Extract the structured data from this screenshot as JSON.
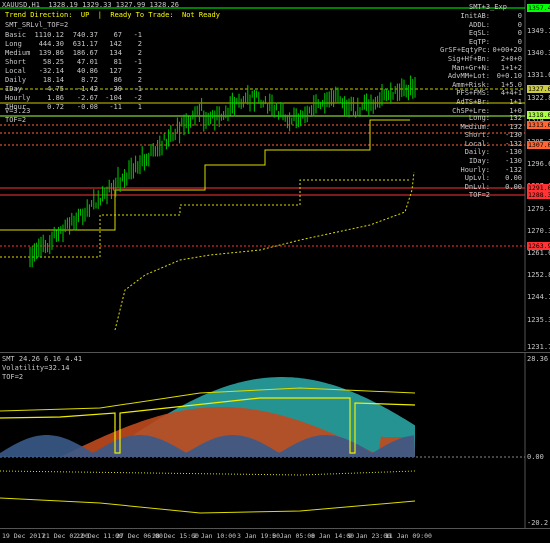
{
  "header": {
    "symbol_line": "XAUUSD,H1  1328.19 1329.33 1327.99 1328.26",
    "trend_line": "Trend Direction:  UP  |  Ready To Trade:  Not Ready",
    "smt_srl_line": "SMT_SRLvl_TOF=2",
    "corner_label": "SMT+3_Exp"
  },
  "stats_table": [
    {
      "name": "Basic",
      "a": "1110.12",
      "b": "740.37",
      "c": "67",
      "d": "-1"
    },
    {
      "name": "Long",
      "a": "444.30",
      "b": "631.17",
      "c": "142",
      "d": "2"
    },
    {
      "name": "Medium",
      "a": "139.86",
      "b": "186.67",
      "c": "134",
      "d": "2"
    },
    {
      "name": "Short",
      "a": "58.25",
      "b": "47.01",
      "c": "81",
      "d": "-1"
    },
    {
      "name": "Local",
      "a": "-32.14",
      "b": "40.86",
      "c": "127",
      "d": "2"
    },
    {
      "name": "Daily",
      "a": "18.14",
      "b": "8.72",
      "c": "86",
      "d": "2"
    },
    {
      "name": "IDay",
      "a": "4.75",
      "b": "-1.42",
      "c": "-30",
      "d": "-1"
    },
    {
      "name": "Hourly",
      "a": "1.86",
      "b": "-2.67",
      "c": "-104",
      "d": "-2"
    },
    {
      "name": "IHour",
      "a": "0.72",
      "b": "-0.08",
      "c": "-11",
      "d": "1"
    }
  ],
  "v_line": "V=3.23",
  "tof_line": "TOF=2",
  "right_panel_top": [
    {
      "label": "InitAB:",
      "value": "0"
    },
    {
      "label": "ADDL:",
      "value": "0"
    },
    {
      "label": "EqSL:",
      "value": "0"
    },
    {
      "label": "EqTP:",
      "value": "0"
    },
    {
      "label": "GrSF+EqtyPc:",
      "value": "0+00+20"
    },
    {
      "label": "Sig+Hf+Bn:",
      "value": "2+0+0"
    },
    {
      "label": "Man+Gr+N:",
      "value": "1+1+2"
    },
    {
      "label": "AdvMM+Lot:",
      "value": "0+0.10"
    },
    {
      "label": "Amm+Risk:",
      "value": "1+5.0"
    },
    {
      "label": "PFS+FMS:",
      "value": "4+4+1"
    },
    {
      "label": "AdTS+Br:",
      "value": "1+1"
    },
    {
      "label": "ChSP+Lre:",
      "value": "1+0"
    }
  ],
  "right_panel_bottom": [
    {
      "label": "Long:",
      "value": "132"
    },
    {
      "label": "Medium:",
      "value": "132"
    },
    {
      "label": "Short:",
      "value": "-130"
    },
    {
      "label": "Local:",
      "value": "-132"
    },
    {
      "label": "Daily:",
      "value": "-130"
    },
    {
      "label": "IDay:",
      "value": "-130"
    },
    {
      "label": "Hourly:",
      "value": "-132"
    },
    {
      "label": "UpLvl:",
      "value": "0.00"
    },
    {
      "label": "DnLvl:",
      "value": "0.00"
    },
    {
      "label": "TOF=2",
      "value": ""
    }
  ],
  "price_axis": {
    "ticks": [
      "1349.10",
      "1340.35",
      "1331.60",
      "1322.85",
      "1314.10",
      "1305.35",
      "1296.60",
      "1287.85",
      "1279.10",
      "1270.35",
      "1261.60",
      "1252.85",
      "1244.10",
      "1235.35"
    ],
    "labels": [
      {
        "text": "1357.40",
        "color": "#00ff00"
      },
      {
        "text": "1327.65",
        "color": "#cccc44"
      },
      {
        "text": "1318.00",
        "color": "#aaff44"
      },
      {
        "text": "1313.60",
        "color": "#ff6633"
      },
      {
        "text": "1307.00",
        "color": "#ff6633"
      },
      {
        "text": "1291.00",
        "color": "#ff3333"
      },
      {
        "text": "1288.30",
        "color": "#ff3333"
      },
      {
        "text": "1263.90",
        "color": "#ff3333"
      }
    ],
    "bottom_tick": "1231.70"
  },
  "indicator": {
    "header": "SMT 24.26 6.16 4.41",
    "volatility": "Volatility=32.14",
    "tof": "TOF=2",
    "axis_top": "28.36",
    "axis_zero": "0.00",
    "axis_bottom": "-20.2"
  },
  "time_axis": [
    "19 Dec 2017",
    "21 Dec 02:00",
    "22 Dec 11:00",
    "27 Dec 06:00",
    "28 Dec 15:00",
    "2 Jan 10:00",
    "3 Jan 19:00",
    "5 Jan 05:00",
    "8 Jan 14:00",
    "9 Jan 23:00",
    "11 Jan 09:00"
  ],
  "colors": {
    "candle": "#00cc00",
    "up_wick": "#00ff00",
    "level": "#cccc00",
    "red_level": "#ff3333",
    "teal": "#2aa3a3",
    "orange": "#c04a1e",
    "blue": "#3a5a8a"
  }
}
